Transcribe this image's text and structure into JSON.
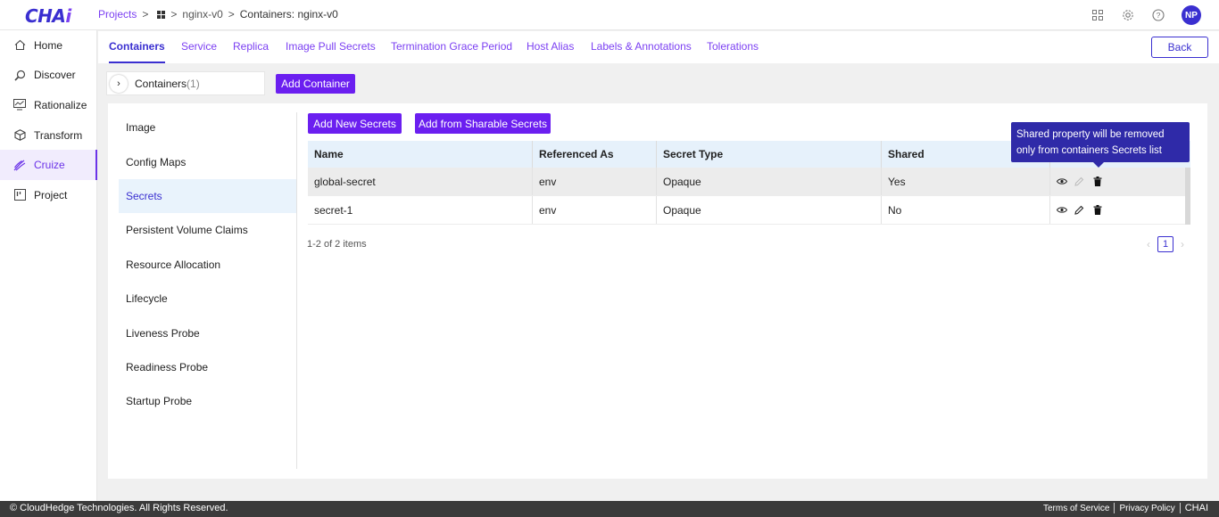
{
  "header": {
    "logo_main": "CHA",
    "logo_accent": "i",
    "breadcrumb": {
      "projects": "Projects",
      "app": "nginx-v0",
      "current": "Containers: nginx-v0"
    },
    "avatar_initials": "NP",
    "icons": [
      "apps-grid-icon",
      "settings-gear-icon",
      "help-icon"
    ]
  },
  "sidebar": {
    "items": [
      {
        "label": "Home",
        "icon": "home-icon"
      },
      {
        "label": "Discover",
        "icon": "discover-icon"
      },
      {
        "label": "Rationalize",
        "icon": "rationalize-icon"
      },
      {
        "label": "Transform",
        "icon": "transform-icon"
      },
      {
        "label": "Cruize",
        "icon": "cruize-icon",
        "active": true
      },
      {
        "label": "Project",
        "icon": "project-icon"
      }
    ]
  },
  "tabs": {
    "items": [
      "Containers",
      "Service",
      "Replica",
      "Image Pull Secrets",
      "Termination Grace Period",
      "Host Alias",
      "Labels & Annotations",
      "Tolerations"
    ],
    "active": "Containers",
    "back_label": "Back"
  },
  "containers": {
    "label": "Containers",
    "count": "(1)",
    "add_label": "Add Container"
  },
  "subnav": {
    "items": [
      "Image",
      "Config Maps",
      "Secrets",
      "Persistent Volume Claims",
      "Resource Allocation",
      "Lifecycle",
      "Liveness Probe",
      "Readiness Probe",
      "Startup Probe"
    ],
    "active": "Secrets"
  },
  "secrets": {
    "add_new_label": "Add New Secrets",
    "add_sharable_label": "Add from Sharable Secrets",
    "columns": [
      "Name",
      "Referenced As",
      "Secret Type",
      "Shared",
      ""
    ],
    "rows": [
      {
        "name": "global-secret",
        "referenced_as": "env",
        "secret_type": "Opaque",
        "shared": "Yes"
      },
      {
        "name": "secret-1",
        "referenced_as": "env",
        "secret_type": "Opaque",
        "shared": "No"
      }
    ],
    "tooltip": "Shared property will be removed only from containers Secrets list",
    "pager_info": "1-2 of 2 items",
    "current_page": "1"
  },
  "footer": {
    "copyright": "© CloudHedge Technologies. All Rights Reserved.",
    "terms": "Terms of Service",
    "privacy": "Privacy Policy",
    "brand": "CHAI"
  },
  "colors": {
    "primary": "#6b1ff0",
    "brand": "#3a2fd0",
    "link": "#7b3ff2",
    "tooltip": "#2f2aa8"
  }
}
